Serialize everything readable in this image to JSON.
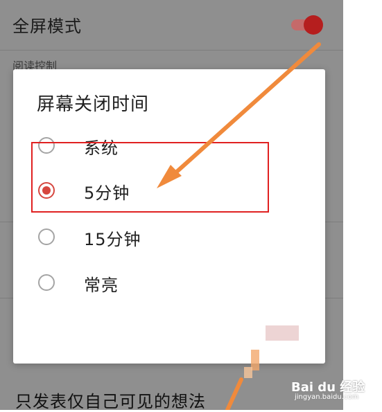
{
  "background": {
    "fullscreen_label": "全屏模式",
    "section_header": "阅读控制",
    "bottom_label": "只发表仅自己可见的想法"
  },
  "dialog": {
    "title": "屏幕关闭时间",
    "options": [
      {
        "label": "系统",
        "checked": false
      },
      {
        "label": "5分钟",
        "checked": true
      },
      {
        "label": "15分钟",
        "checked": false
      },
      {
        "label": "常亮",
        "checked": false
      }
    ]
  },
  "watermark": {
    "logo": "Bai du 经验",
    "url": "jingyan.baidu.com"
  },
  "colors": {
    "accent": "#d6463e",
    "annotation_red": "#e02020",
    "annotation_arrow": "#f08a3c"
  }
}
